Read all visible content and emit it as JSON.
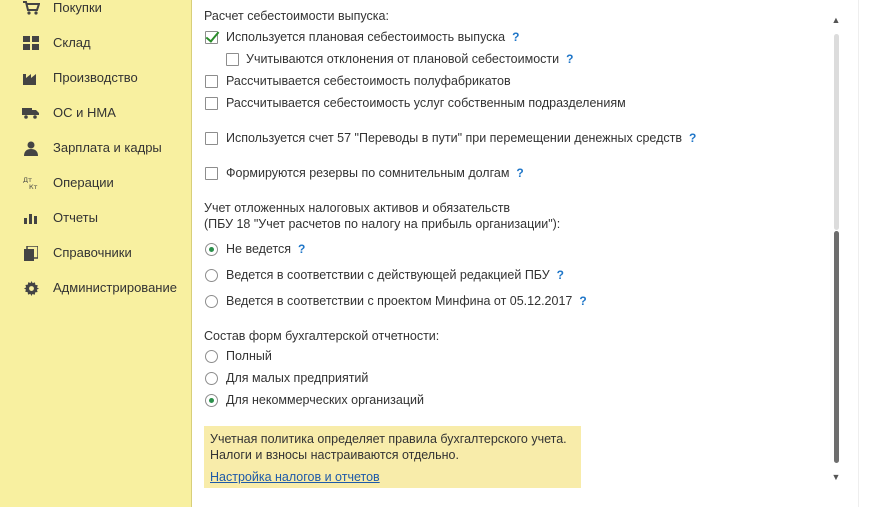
{
  "sidebar": {
    "items": [
      {
        "label": "Покупки",
        "icon": "cart-icon"
      },
      {
        "label": "Склад",
        "icon": "warehouse-icon"
      },
      {
        "label": "Производство",
        "icon": "factory-icon"
      },
      {
        "label": "ОС и НМА",
        "icon": "truck-icon"
      },
      {
        "label": "Зарплата и кадры",
        "icon": "person-icon"
      },
      {
        "label": "Операции",
        "icon": "debit-credit-icon"
      },
      {
        "label": "Отчеты",
        "icon": "bar-chart-icon"
      },
      {
        "label": "Справочники",
        "icon": "books-icon"
      },
      {
        "label": "Администрирование",
        "icon": "gear-icon"
      }
    ]
  },
  "cost": {
    "heading": "Расчет себестоимости выпуска:",
    "planned": {
      "label": "Используется плановая себестоимость выпуска",
      "checked": true
    },
    "deviations": {
      "label": "Учитываются отклонения от плановой себестоимости",
      "checked": false
    },
    "semi": {
      "label": "Рассчитывается себестоимость полуфабрикатов",
      "checked": false
    },
    "services": {
      "label": "Рассчитывается себестоимость услуг собственным подразделениям",
      "checked": false
    }
  },
  "account57": {
    "label": "Используется счет 57 \"Переводы в пути\" при перемещении денежных средств",
    "checked": false
  },
  "reserves": {
    "label": "Формируются резервы по сомнительным долгам",
    "checked": false
  },
  "deferred": {
    "heading_line1": "Учет отложенных налоговых активов и обязательств",
    "heading_line2": "(ПБУ 18 \"Учет расчетов по налогу на прибыль организации\"):",
    "options": [
      {
        "label": "Не ведется",
        "selected": true
      },
      {
        "label": "Ведется в соответствии с действующей редакцией ПБУ",
        "selected": false
      },
      {
        "label": "Ведется в соответствии с проектом Минфина от 05.12.2017",
        "selected": false
      }
    ]
  },
  "forms": {
    "heading": "Состав форм бухгалтерской отчетности:",
    "options": [
      {
        "label": "Полный",
        "selected": false
      },
      {
        "label": "Для малых предприятий",
        "selected": false
      },
      {
        "label": "Для некоммерческих организаций",
        "selected": true
      }
    ]
  },
  "note": {
    "line1": "Учетная политика определяет правила бухгалтерского учета.",
    "line2": "Налоги и взносы настраиваются отдельно.",
    "link": "Настройка налогов и отчетов"
  },
  "help_mark": "?",
  "colors": {
    "sidebar_bg": "#f8f0a0",
    "note_bg": "#f8ecaa",
    "help": "#1f76c8",
    "check": "#2a8c2a"
  }
}
